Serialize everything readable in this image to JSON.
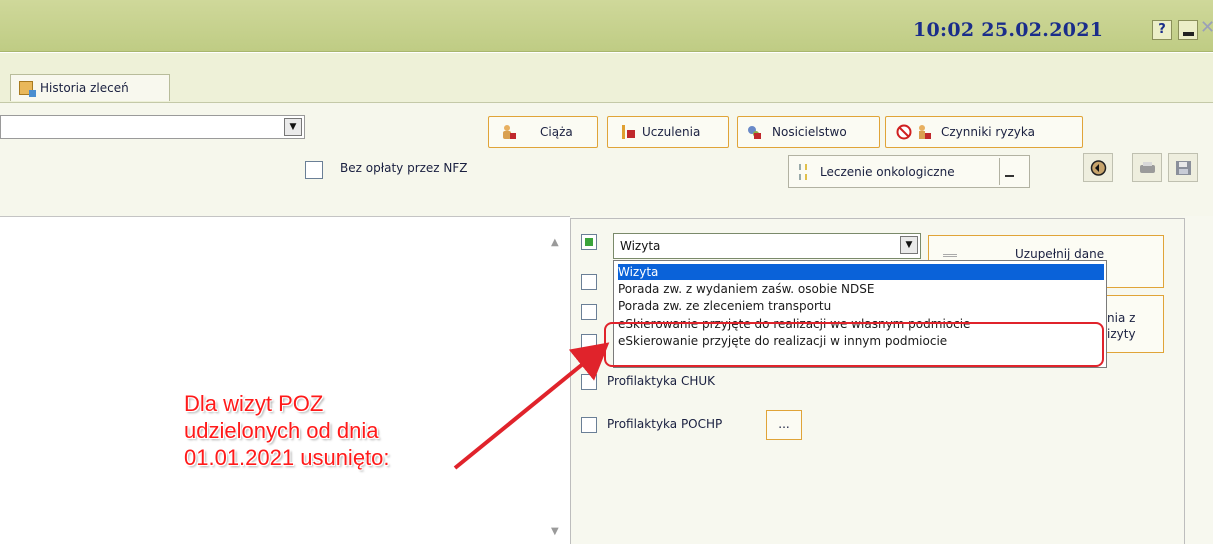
{
  "titlebar": {
    "clock": "10:02 25.02.2021",
    "help_label": "?",
    "close_label": "✕"
  },
  "tabs": [
    {
      "label": "Historia zleceń"
    }
  ],
  "header": {
    "buttons": {
      "ciaza": "Ciąża",
      "uczulenia": "Uczulenia",
      "nosicielstwo": "Nosicielstwo",
      "czynniki_ryzyka": "Czynniki ryzyka"
    },
    "bez_oplaty_label": "Bez opłaty przez NFZ",
    "leczenie_onkologiczne": "Leczenie onkologiczne"
  },
  "visit": {
    "selected": "Wizyta",
    "options": [
      "Wizyta",
      "Porada zw. z wydaniem zaśw. osobie NDSE",
      "Porada zw. ze zleceniem transportu",
      "eSkierowanie przyjęte do realizacji we własnym podmiocie",
      "eSkierowanie przyjęte do realizacji w innym podmiocie"
    ]
  },
  "buttons": {
    "uzupelnij_dane": "Uzupełnij dane",
    "second_line1": "nia z",
    "second_line2": "izyty",
    "more": "..."
  },
  "checkbox_labels": {
    "chuk": "Profilaktyka CHUK",
    "pochp": "Profilaktyka POCHP"
  },
  "annotation": {
    "lines": [
      "Dla wizyt POZ",
      "udzielonych od dnia",
      "01.01.2021 usunięto:"
    ],
    "color": "#ff1a1a"
  },
  "colors": {
    "titlebar": "#c7d290",
    "clock": "#1a2d8a",
    "accent_border": "#e0a438",
    "selection": "#0a62d9"
  }
}
